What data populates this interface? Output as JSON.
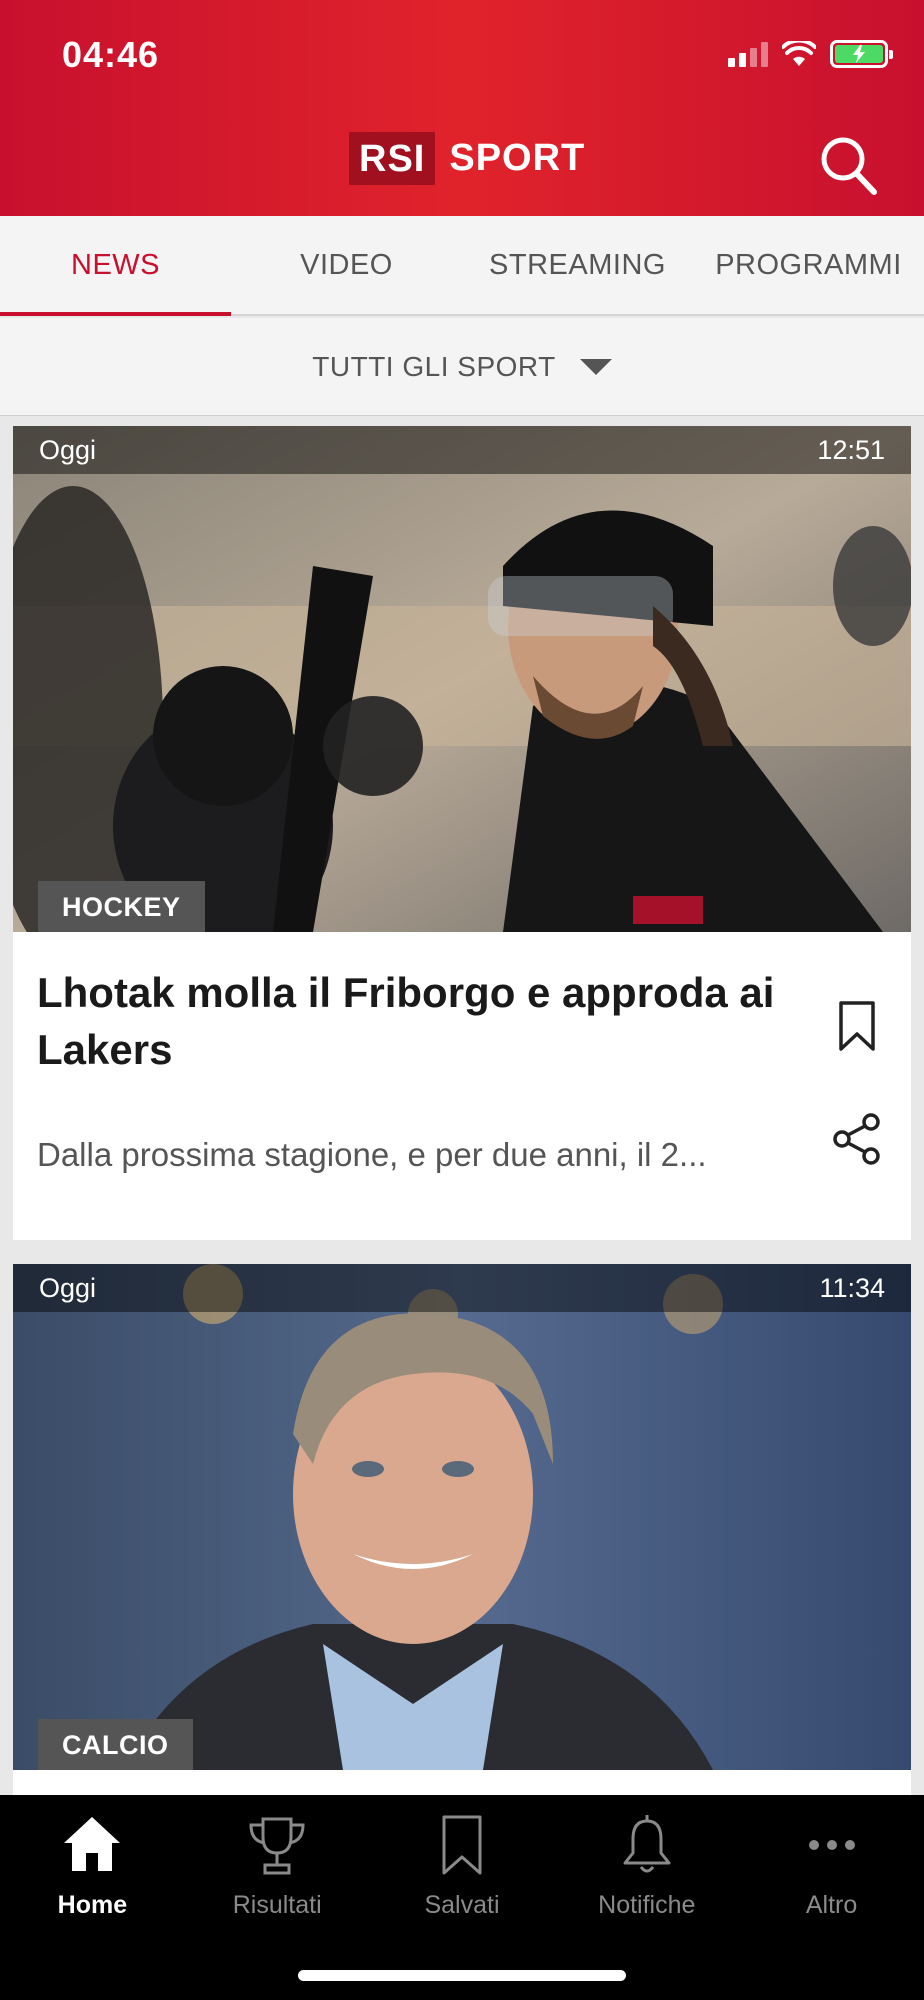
{
  "status_bar": {
    "time": "04:46"
  },
  "header": {
    "logo_box": "RSI",
    "logo_text": "SPORT"
  },
  "tabs": [
    {
      "label": "NEWS",
      "active": true
    },
    {
      "label": "VIDEO",
      "active": false
    },
    {
      "label": "STREAMING",
      "active": false
    },
    {
      "label": "PROGRAMMI",
      "active": false
    }
  ],
  "filter": {
    "label": "TUTTI GLI SPORT"
  },
  "articles": [
    {
      "day": "Oggi",
      "time": "12:51",
      "category": "HOCKEY",
      "title": "Lhotak molla il Friborgo e approda ai Lakers",
      "description": "Dalla prossima stagione, e per due anni, il 2..."
    },
    {
      "day": "Oggi",
      "time": "11:34",
      "category": "CALCIO"
    }
  ],
  "bottom_nav": [
    {
      "label": "Home",
      "icon": "home-icon",
      "active": true
    },
    {
      "label": "Risultati",
      "icon": "trophy-icon",
      "active": false
    },
    {
      "label": "Salvati",
      "icon": "bookmark-icon",
      "active": false
    },
    {
      "label": "Notifiche",
      "icon": "bell-icon",
      "active": false
    },
    {
      "label": "Altro",
      "icon": "more-icon",
      "active": false
    }
  ],
  "colors": {
    "brand_red": "#c8102e",
    "logo_dark_red": "#a0101f",
    "battery_green": "#4cd964"
  }
}
